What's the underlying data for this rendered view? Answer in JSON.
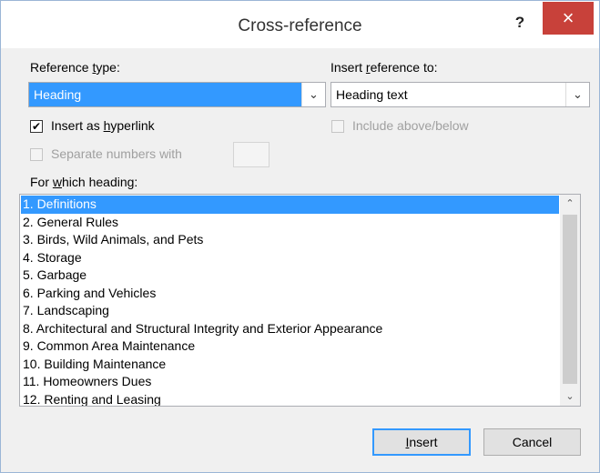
{
  "window": {
    "title": "Cross-reference",
    "help_label": "?",
    "close_label": "×"
  },
  "reference_type": {
    "label_pre": "Reference ",
    "label_u": "t",
    "label_post": "ype:",
    "value": "Heading",
    "arrow": "⌄"
  },
  "insert_reference_to": {
    "label_pre": "Insert ",
    "label_u": "r",
    "label_post": "eference to:",
    "value": "Heading text",
    "arrow": "⌄"
  },
  "insert_as_hyperlink": {
    "label_pre": "Insert as ",
    "label_u": "h",
    "label_post": "yperlink",
    "checked": true,
    "check_glyph": "✔"
  },
  "include_above_below": {
    "label": "Include above/below",
    "checked": false,
    "enabled": false
  },
  "separate_numbers_with": {
    "label": "Separate numbers with",
    "checked": false,
    "enabled": false,
    "value": ""
  },
  "for_which_heading": {
    "label_pre": "For ",
    "label_u": "w",
    "label_post": "hich heading:",
    "selected_index": 0,
    "items": [
      "1. Definitions",
      "2. General Rules",
      "3. Birds, Wild Animals, and Pets",
      "4. Storage",
      "5. Garbage",
      "6. Parking and Vehicles",
      "7. Landscaping",
      "8. Architectural and Structural Integrity and Exterior Appearance",
      "9. Common Area Maintenance",
      "10. Building Maintenance",
      "11. Homeowners Dues",
      "12. Renting and Leasing"
    ],
    "scroll_up_glyph": "⌃",
    "scroll_down_glyph": "⌄"
  },
  "buttons": {
    "insert_u": "I",
    "insert_post": "nsert",
    "cancel": "Cancel"
  },
  "colors": {
    "selection": "#3399ff",
    "close_button": "#c8413a",
    "dialog_background": "#f0f0f0"
  }
}
